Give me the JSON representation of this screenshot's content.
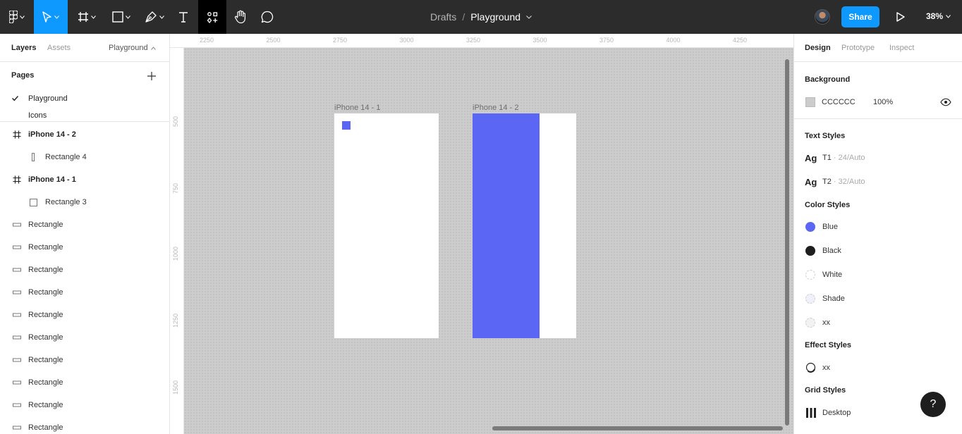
{
  "toolbar": {
    "menu_icon": "figma-logo-icon",
    "tools": [
      "move-tool",
      "frame-tool",
      "shape-tool",
      "pen-tool",
      "text-tool",
      "components-tool",
      "hand-tool",
      "comment-tool"
    ],
    "breadcrumb": {
      "folder": "Drafts",
      "separator": "/",
      "file": "Playground"
    },
    "share_label": "Share",
    "zoom": "38%",
    "accent_color": "#0d99ff"
  },
  "left_panel": {
    "tabs": {
      "layers": "Layers",
      "assets": "Assets"
    },
    "page_switch": "Playground",
    "pages_title": "Pages",
    "pages": [
      {
        "name": "Playground",
        "current": true
      },
      {
        "name": "Icons",
        "current": false
      }
    ],
    "layers": [
      {
        "name": "iPhone 14 - 2",
        "type": "frame"
      },
      {
        "name": "Rectangle 4",
        "type": "rect-tall"
      },
      {
        "name": "iPhone 14 - 1",
        "type": "frame"
      },
      {
        "name": "Rectangle 3",
        "type": "rect-square"
      },
      {
        "name": "Rectangle",
        "type": "rect-wide"
      },
      {
        "name": "Rectangle",
        "type": "rect-wide"
      },
      {
        "name": "Rectangle",
        "type": "rect-wide"
      },
      {
        "name": "Rectangle",
        "type": "rect-wide"
      },
      {
        "name": "Rectangle",
        "type": "rect-wide"
      },
      {
        "name": "Rectangle",
        "type": "rect-wide"
      },
      {
        "name": "Rectangle",
        "type": "rect-wide"
      },
      {
        "name": "Rectangle",
        "type": "rect-wide"
      },
      {
        "name": "Rectangle",
        "type": "rect-wide"
      },
      {
        "name": "Rectangle",
        "type": "rect-wide"
      }
    ]
  },
  "rulers": {
    "top": [
      "2250",
      "2500",
      "2750",
      "3000",
      "3250",
      "3500",
      "3750",
      "4000",
      "4250"
    ],
    "left": [
      "500",
      "750",
      "1000",
      "1250",
      "1500"
    ]
  },
  "canvas": {
    "background": "#cccccc",
    "frames": [
      {
        "label": "iPhone 14 - 1"
      },
      {
        "label": "iPhone 14 - 2"
      }
    ],
    "rect_color": "#5c66f5"
  },
  "right_panel": {
    "tabs": {
      "design": "Design",
      "prototype": "Prototype",
      "inspect": "Inspect"
    },
    "background": {
      "title": "Background",
      "hex": "CCCCCC",
      "opacity": "100%"
    },
    "text_styles": {
      "title": "Text Styles",
      "items": [
        {
          "preview": "Ag",
          "name": "T1",
          "meta": " · 24/Auto"
        },
        {
          "preview": "Ag",
          "name": "T2",
          "meta": " · 32/Auto"
        }
      ]
    },
    "color_styles": {
      "title": "Color Styles",
      "items": [
        {
          "name": "Blue",
          "color": "#5c66f5"
        },
        {
          "name": "Black",
          "color": "#1e1e1e"
        },
        {
          "name": "White",
          "color": "#ffffff"
        },
        {
          "name": "Shade",
          "color": "#eef0fa"
        },
        {
          "name": "xx",
          "color": "#f2f2f2"
        }
      ]
    },
    "effect_styles": {
      "title": "Effect Styles",
      "items": [
        {
          "name": "xx"
        }
      ]
    },
    "grid_styles": {
      "title": "Grid Styles",
      "items": [
        {
          "name": "Desktop"
        }
      ]
    },
    "help_label": "?"
  }
}
